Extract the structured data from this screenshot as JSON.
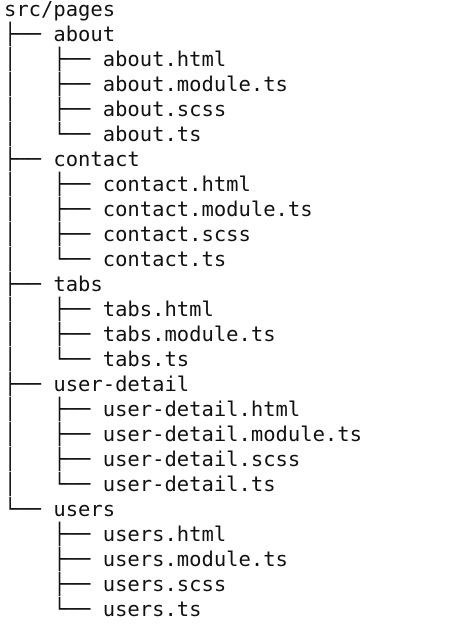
{
  "tree": {
    "root": "src/pages",
    "lines": [
      {
        "prefix": "├── ",
        "name": "about",
        "kind": "folder"
      },
      {
        "prefix": "│   ├── ",
        "name": "about.html",
        "kind": "file"
      },
      {
        "prefix": "│   ├── ",
        "name": "about.module.ts",
        "kind": "file"
      },
      {
        "prefix": "│   ├── ",
        "name": "about.scss",
        "kind": "file"
      },
      {
        "prefix": "│   └── ",
        "name": "about.ts",
        "kind": "file"
      },
      {
        "prefix": "├── ",
        "name": "contact",
        "kind": "folder"
      },
      {
        "prefix": "│   ├── ",
        "name": "contact.html",
        "kind": "file"
      },
      {
        "prefix": "│   ├── ",
        "name": "contact.module.ts",
        "kind": "file"
      },
      {
        "prefix": "│   ├── ",
        "name": "contact.scss",
        "kind": "file"
      },
      {
        "prefix": "│   └── ",
        "name": "contact.ts",
        "kind": "file"
      },
      {
        "prefix": "├── ",
        "name": "tabs",
        "kind": "folder"
      },
      {
        "prefix": "│   ├── ",
        "name": "tabs.html",
        "kind": "file"
      },
      {
        "prefix": "│   ├── ",
        "name": "tabs.module.ts",
        "kind": "file"
      },
      {
        "prefix": "│   └── ",
        "name": "tabs.ts",
        "kind": "file"
      },
      {
        "prefix": "├── ",
        "name": "user-detail",
        "kind": "folder"
      },
      {
        "prefix": "│   ├── ",
        "name": "user-detail.html",
        "kind": "file"
      },
      {
        "prefix": "│   ├── ",
        "name": "user-detail.module.ts",
        "kind": "file"
      },
      {
        "prefix": "│   ├── ",
        "name": "user-detail.scss",
        "kind": "file"
      },
      {
        "prefix": "│   └── ",
        "name": "user-detail.ts",
        "kind": "file"
      },
      {
        "prefix": "└── ",
        "name": "users",
        "kind": "folder"
      },
      {
        "prefix": "    ├── ",
        "name": "users.html",
        "kind": "file"
      },
      {
        "prefix": "    ├── ",
        "name": "users.module.ts",
        "kind": "file"
      },
      {
        "prefix": "    ├── ",
        "name": "users.scss",
        "kind": "file"
      },
      {
        "prefix": "    └── ",
        "name": "users.ts",
        "kind": "file"
      }
    ]
  }
}
